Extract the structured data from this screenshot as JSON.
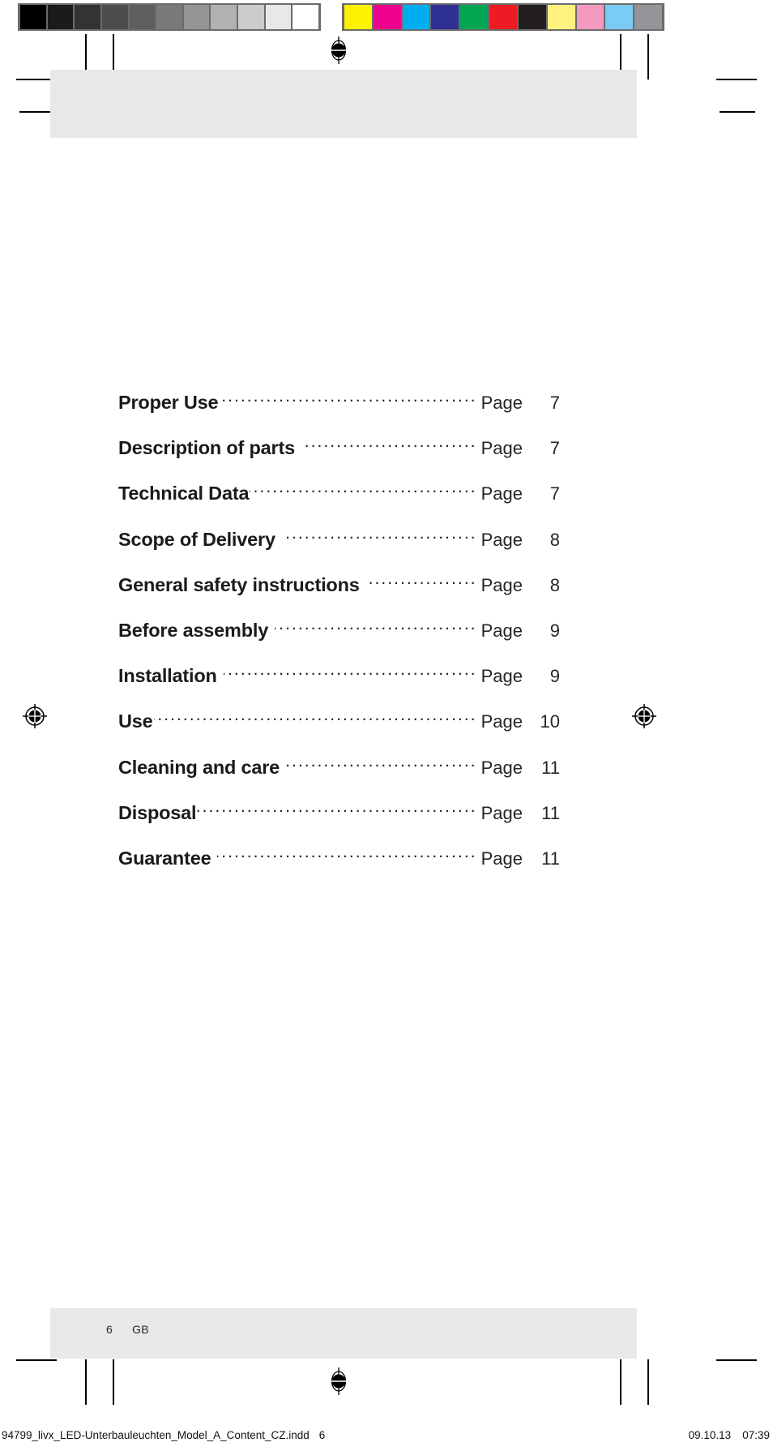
{
  "document": {
    "kind": "print-proof-page",
    "page_label": "6",
    "language_code": "GB"
  },
  "color_bars": {
    "grayscale_group_name": "grayscale-calibration-bar",
    "grayscale": [
      "#000000",
      "#1b1b1b",
      "#333333",
      "#4d4d4d",
      "#5e5e5e",
      "#797979",
      "#959595",
      "#b1b1b1",
      "#cccccc",
      "#e8e8e8",
      "#ffffff"
    ],
    "color_group_name": "process-color-calibration-bar",
    "colors": [
      "#fff200",
      "#ec008c",
      "#00aeef",
      "#2e3192",
      "#00a651",
      "#ed1c24",
      "#231f20",
      "#fff27f",
      "#f49ac1",
      "#7accf4",
      "#939598"
    ]
  },
  "toc": {
    "entries": [
      {
        "title": "Proper Use",
        "page_label": "Page",
        "page": "7",
        "space_before_leader": false
      },
      {
        "title": "Description of parts",
        "page_label": "Page",
        "page": "7",
        "space_before_leader": true
      },
      {
        "title": "Technical Data",
        "page_label": "Page",
        "page": "7",
        "space_before_leader": false
      },
      {
        "title": "Scope of Delivery",
        "page_label": "Page",
        "page": "8",
        "space_before_leader": true
      },
      {
        "title": "General safety instructions",
        "page_label": "Page",
        "page": "8",
        "space_before_leader": true
      },
      {
        "title": "Before assembly",
        "page_label": "Page",
        "page": "9",
        "space_before_leader": true
      },
      {
        "title": "Installation",
        "page_label": "Page",
        "page": "9",
        "space_before_leader": true
      },
      {
        "title": "Use",
        "page_label": "Page",
        "page": "10",
        "space_before_leader": false
      },
      {
        "title": "Cleaning and care",
        "page_label": "Page",
        "page": "11",
        "space_before_leader": true
      },
      {
        "title": "Disposal",
        "page_label": "Page",
        "page": "11",
        "space_before_leader": false
      },
      {
        "title": "Guarantee",
        "page_label": "Page",
        "page": "11",
        "space_before_leader": true
      }
    ]
  },
  "footer": {
    "page_number": "6",
    "language_code": "GB"
  },
  "slug": {
    "filename": "94799_livx_LED-Unterbauleuchten_Model_A_Content_CZ.indd",
    "page": "6",
    "date": "09.10.13",
    "time": "07:39"
  },
  "marks": {
    "registration_icon": "registration-target-icon",
    "crop_mark_icon": "crop-mark"
  },
  "palette": {
    "band_gray": "#e8e8e8",
    "text_black": "#1b1b1b",
    "page_text": "#262626"
  }
}
